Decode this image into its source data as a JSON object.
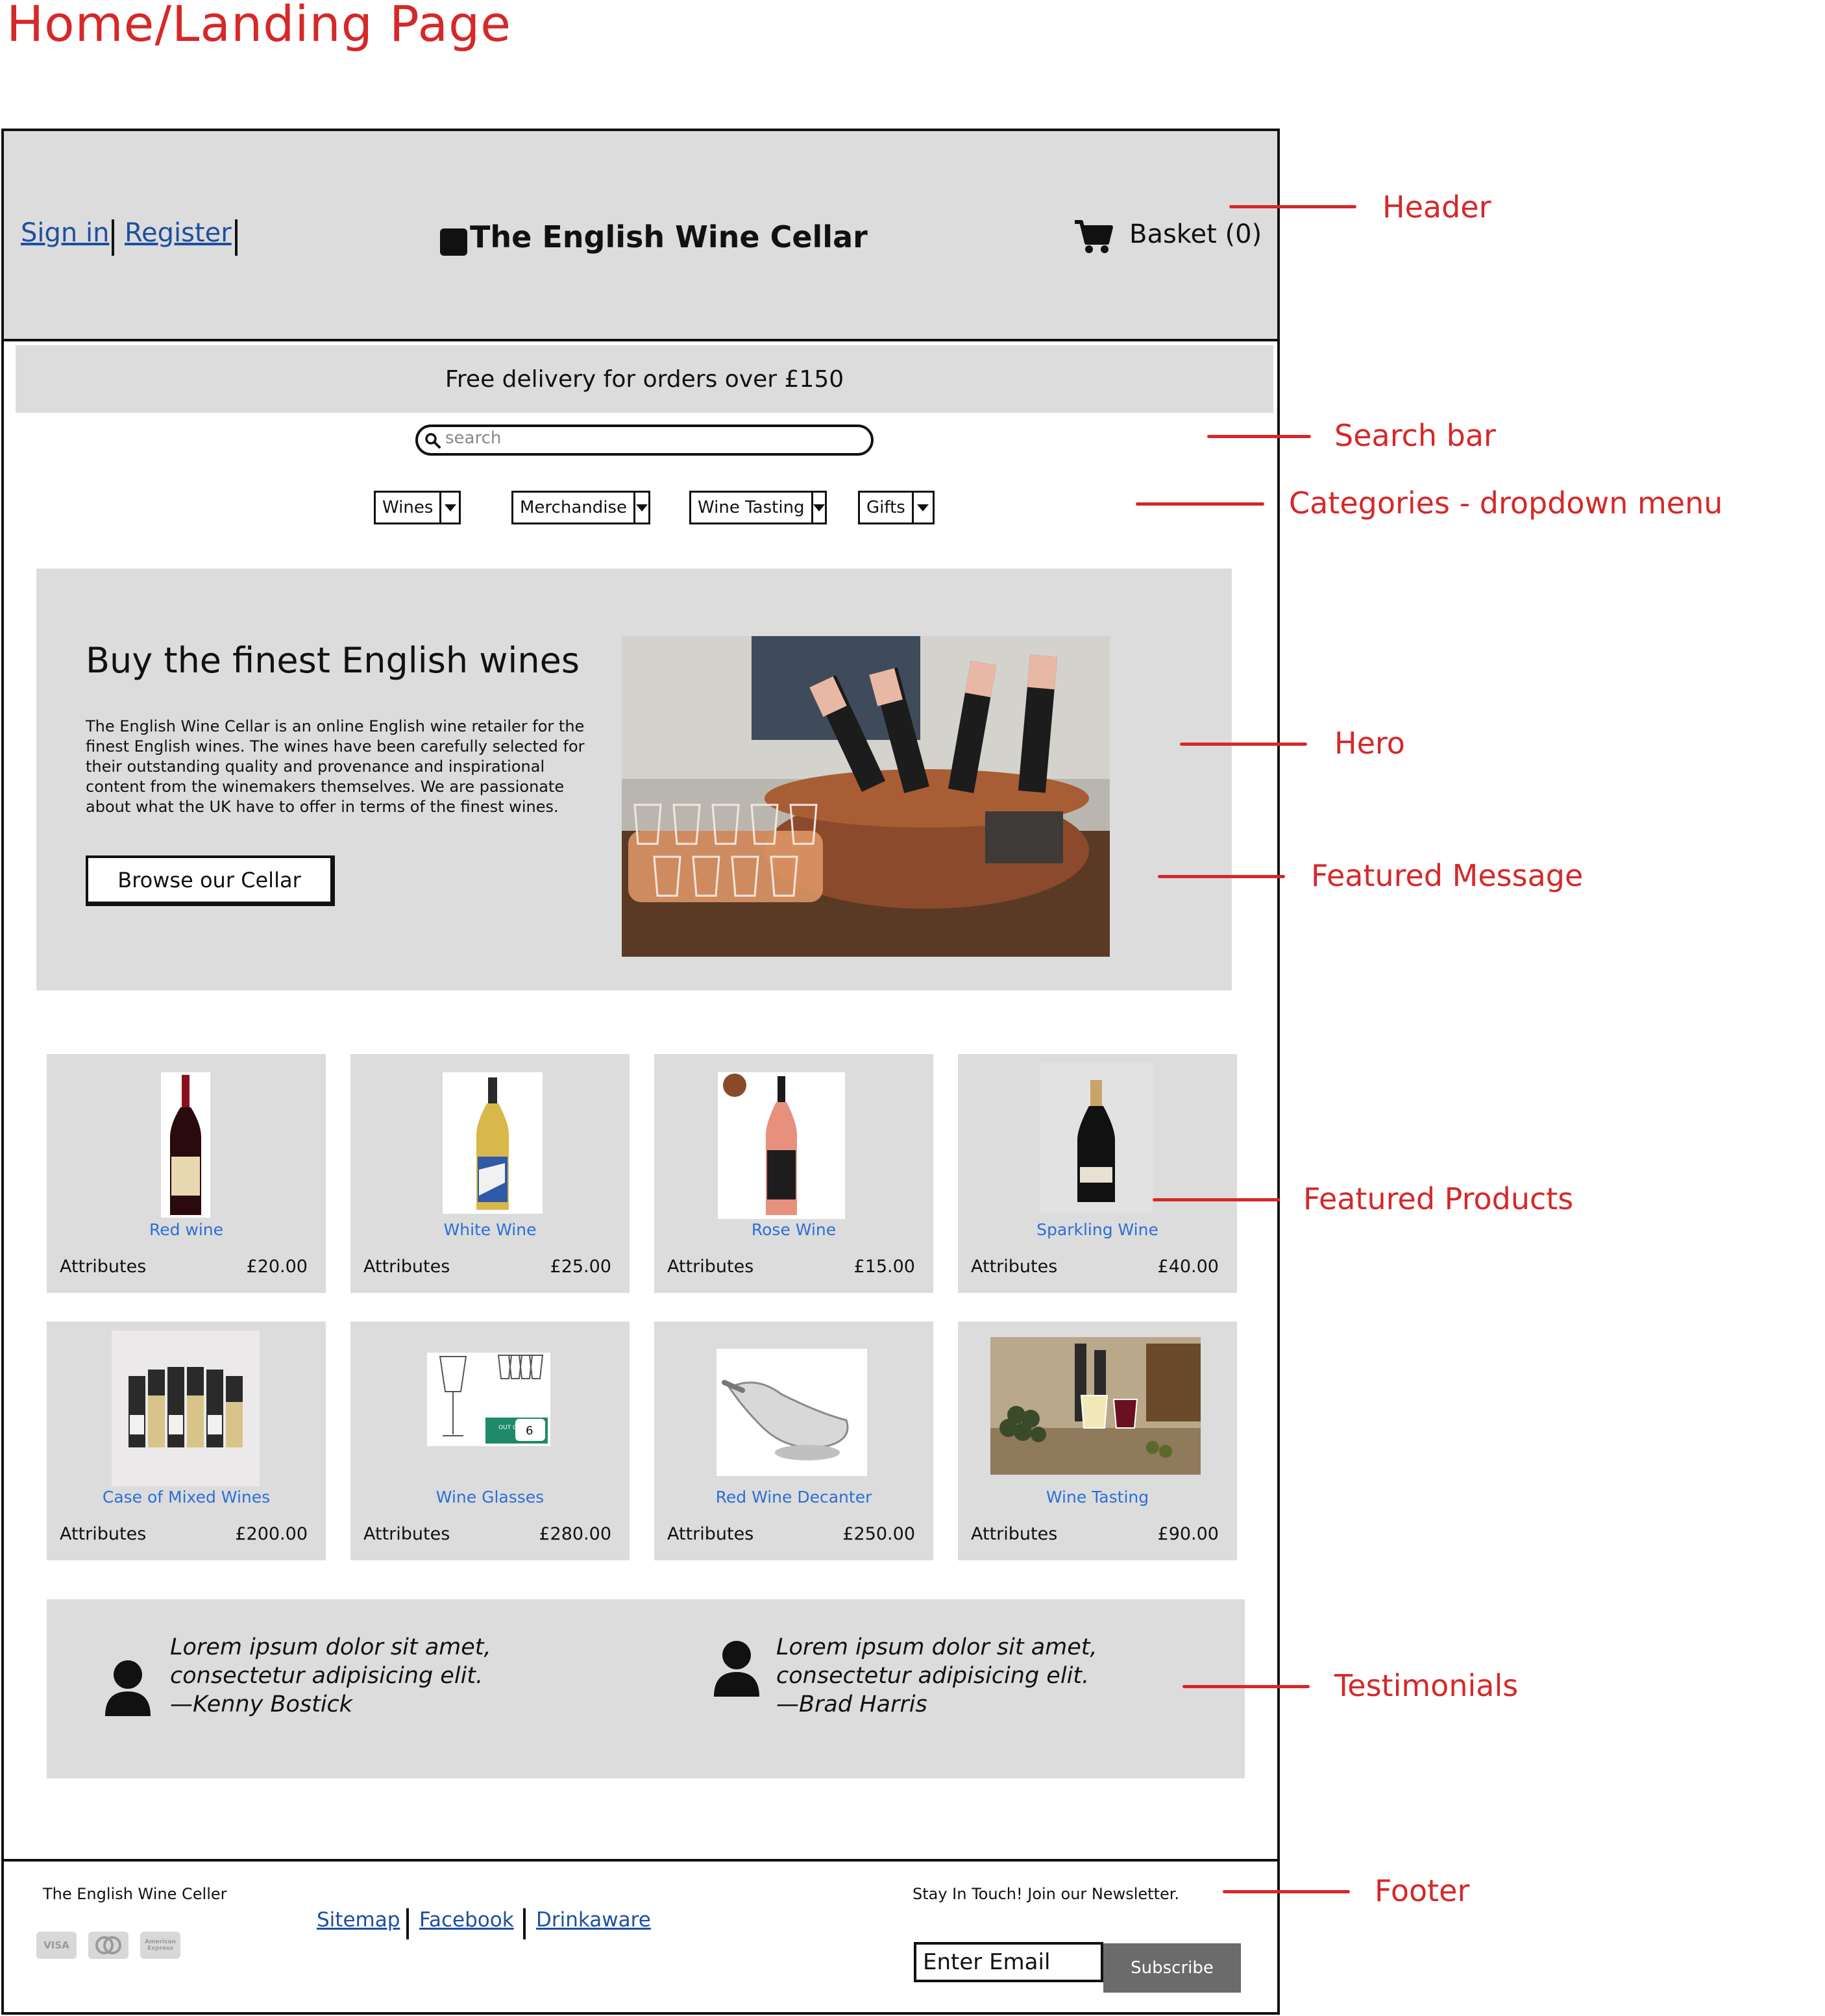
{
  "page_title": "Home/Landing Page",
  "annotations": {
    "header": "Header",
    "search": "Search bar",
    "categories": "Categories - dropdown menu",
    "hero": "Hero",
    "featured_message": "Featured Message",
    "featured_products": "Featured Products",
    "testimonials": "Testimonials",
    "footer": "Footer"
  },
  "header": {
    "sign_in": "Sign in",
    "register": "Register",
    "site_name": "The English Wine Cellar",
    "basket": "Basket (0)"
  },
  "promo": "Free delivery for orders over £150",
  "search": {
    "placeholder": "search"
  },
  "categories": [
    "Wines",
    "Merchandise",
    "Wine Tasting",
    "Gifts"
  ],
  "hero": {
    "title": "Buy the finest English wines",
    "description": "The English Wine Cellar is an online English wine retailer for the finest English wines. The wines have been carefully selected for their outstanding quality and provenance and inspirational content from the winemakers themselves. We are passionate about what the UK have to offer in terms of the finest wines.",
    "button": "Browse our Cellar"
  },
  "products": [
    {
      "name": "Red wine",
      "attributes": "Attributes",
      "price": "£20.00"
    },
    {
      "name": "White Wine",
      "attributes": "Attributes",
      "price": "£25.00"
    },
    {
      "name": "Rose Wine",
      "attributes": "Attributes",
      "price": "£15.00"
    },
    {
      "name": "Sparkling Wine",
      "attributes": "Attributes",
      "price": "£40.00"
    },
    {
      "name": "Case of Mixed Wines",
      "attributes": "Attributes",
      "price": "£200.00"
    },
    {
      "name": "Wine Glasses",
      "attributes": "Attributes",
      "price": "£280.00"
    },
    {
      "name": "Red Wine Decanter",
      "attributes": "Attributes",
      "price": "£250.00"
    },
    {
      "name": "Wine Tasting",
      "attributes": "Attributes",
      "price": "£90.00"
    }
  ],
  "badges": {
    "out_of_stock": "OUT OF STOCK",
    "pack_count": "6"
  },
  "testimonials": [
    {
      "line1": "Lorem ipsum dolor sit amet,",
      "line2": "consectetur adipisicing elit.",
      "author": "—Kenny Bostick"
    },
    {
      "line1": "Lorem ipsum dolor sit amet,",
      "line2": "consectetur adipisicing elit.",
      "author": "—Brad Harris"
    }
  ],
  "footer": {
    "company": "The English Wine Celler",
    "links": [
      "Sitemap",
      "Facebook",
      "Drinkaware"
    ],
    "newsletter": "Stay In Touch! Join our Newsletter.",
    "email_placeholder": "Enter Email",
    "subscribe": "Subscribe",
    "payments": [
      "VISA",
      "Mastercard",
      "American Express"
    ]
  },
  "colors": {
    "annotation": "#d62828",
    "link": "#1d4fa0",
    "product_link": "#2b6fd6",
    "panel": "#dcdcdc"
  }
}
